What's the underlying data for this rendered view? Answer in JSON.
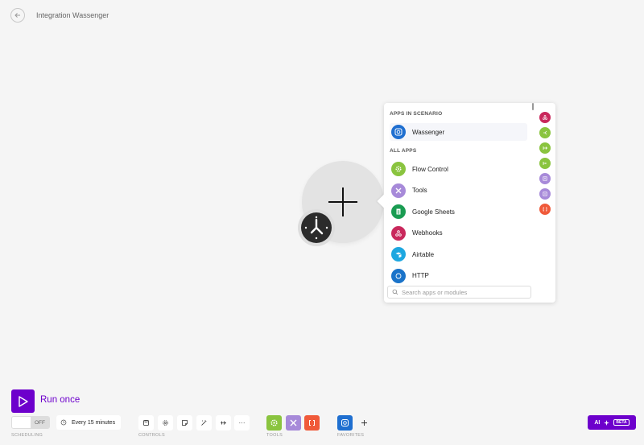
{
  "header": {
    "title": "Integration Wassenger"
  },
  "popover": {
    "apps_in_scenario_label": "APPS IN SCENARIO",
    "apps_in_scenario": [
      {
        "name": "Wassenger",
        "color": "#1f6fd0",
        "icon": "wassenger-icon"
      }
    ],
    "all_apps_label": "ALL APPS",
    "all_apps": [
      {
        "name": "Flow Control",
        "color": "#8ac43f",
        "icon": "gear-icon"
      },
      {
        "name": "Tools",
        "color": "#a78ad9",
        "icon": "tools-icon"
      },
      {
        "name": "Google Sheets",
        "color": "#1a9c52",
        "icon": "google-sheets-icon"
      },
      {
        "name": "Webhooks",
        "color": "#c9285c",
        "icon": "webhooks-icon"
      },
      {
        "name": "Airtable",
        "color": "#1da7e0",
        "icon": "airtable-icon"
      },
      {
        "name": "HTTP",
        "color": "#1a73c9",
        "icon": "http-icon"
      }
    ],
    "search_placeholder": "Search apps or modules",
    "rail_colors": [
      "#c9285c",
      "#8ac43f",
      "#8ac43f",
      "#8ac43f",
      "#a78ad9",
      "#a78ad9",
      "#f05a3a"
    ]
  },
  "toolbar": {
    "run_once_label": "Run once",
    "scheduling_toggle_state": "OFF",
    "schedule_interval": "Every 15 minutes",
    "scheduling_label": "SCHEDULING",
    "controls_label": "CONTROLS",
    "tools_label": "TOOLS",
    "favorites_label": "FAVORITES",
    "more_label": "···",
    "ai_label": "AI",
    "beta_label": "BETA",
    "accent_color": "#6d00cc"
  }
}
